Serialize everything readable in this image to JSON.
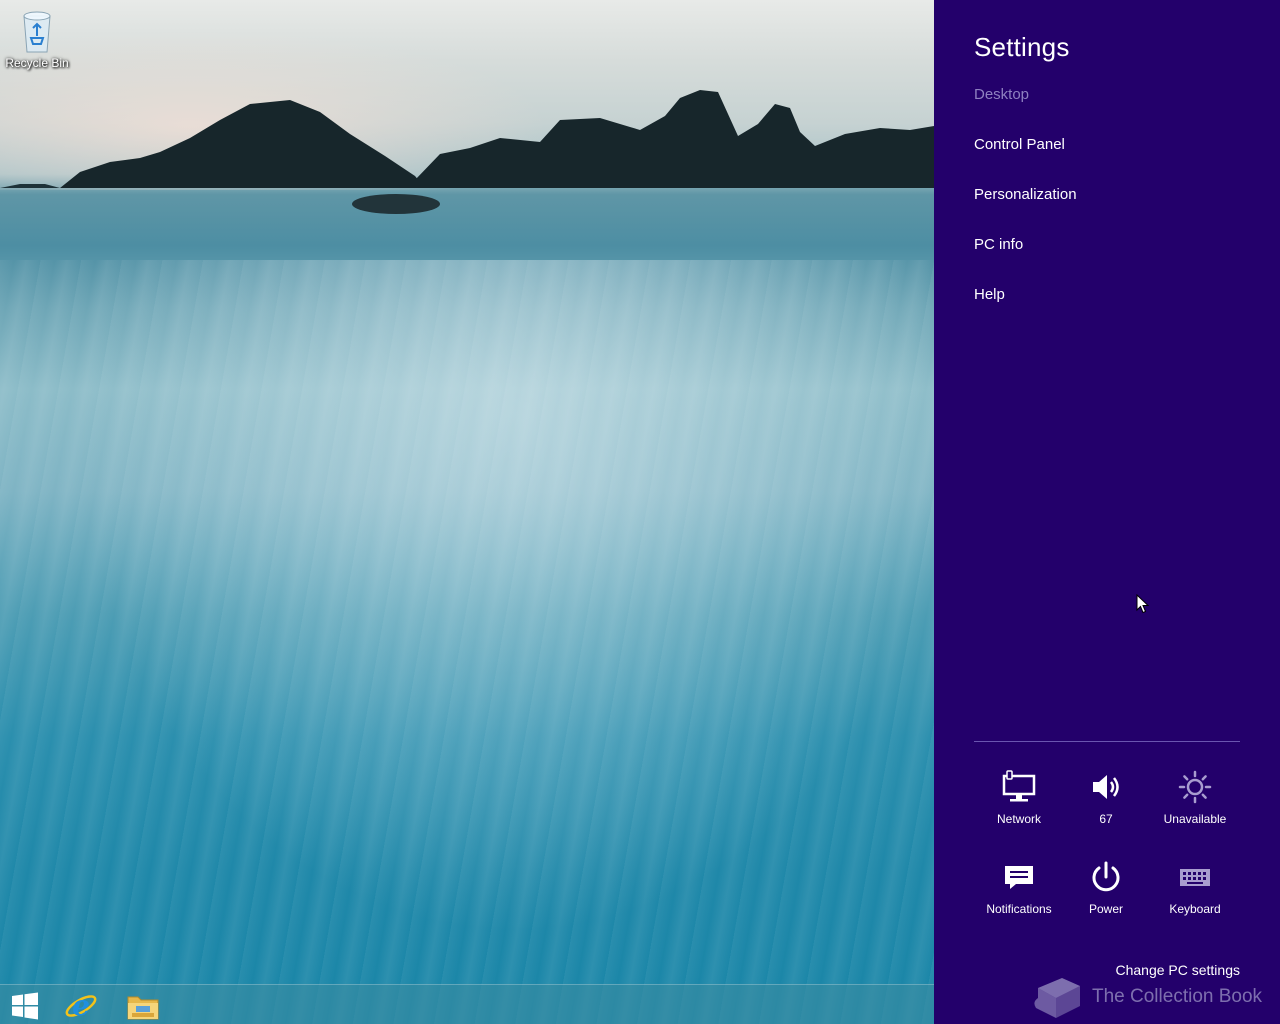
{
  "desktop": {
    "icons": [
      {
        "label": "Recycle Bin",
        "icon": "recycle-bin-icon"
      }
    ]
  },
  "taskbar": {
    "items": [
      {
        "name": "Start",
        "icon": "windows-logo-icon"
      },
      {
        "name": "Internet Explorer",
        "icon": "internet-explorer-icon"
      },
      {
        "name": "File Explorer",
        "icon": "file-explorer-icon"
      }
    ]
  },
  "charm": {
    "title": "Settings",
    "context": "Desktop",
    "links": {
      "control_panel": "Control Panel",
      "personalization": "Personalization",
      "pc_info": "PC info",
      "help": "Help"
    },
    "quick_settings": {
      "network": {
        "label": "Network",
        "icon": "network-icon"
      },
      "volume": {
        "label": "67",
        "icon": "speaker-icon"
      },
      "brightness": {
        "label": "Unavailable",
        "icon": "brightness-icon"
      },
      "notifications": {
        "label": "Notifications",
        "icon": "notifications-icon"
      },
      "power": {
        "label": "Power",
        "icon": "power-icon"
      },
      "keyboard": {
        "label": "Keyboard",
        "icon": "keyboard-icon"
      }
    },
    "change_pc_settings": "Change PC settings",
    "background_color": "#23006b"
  },
  "watermark": {
    "text": "The Collection Book"
  }
}
